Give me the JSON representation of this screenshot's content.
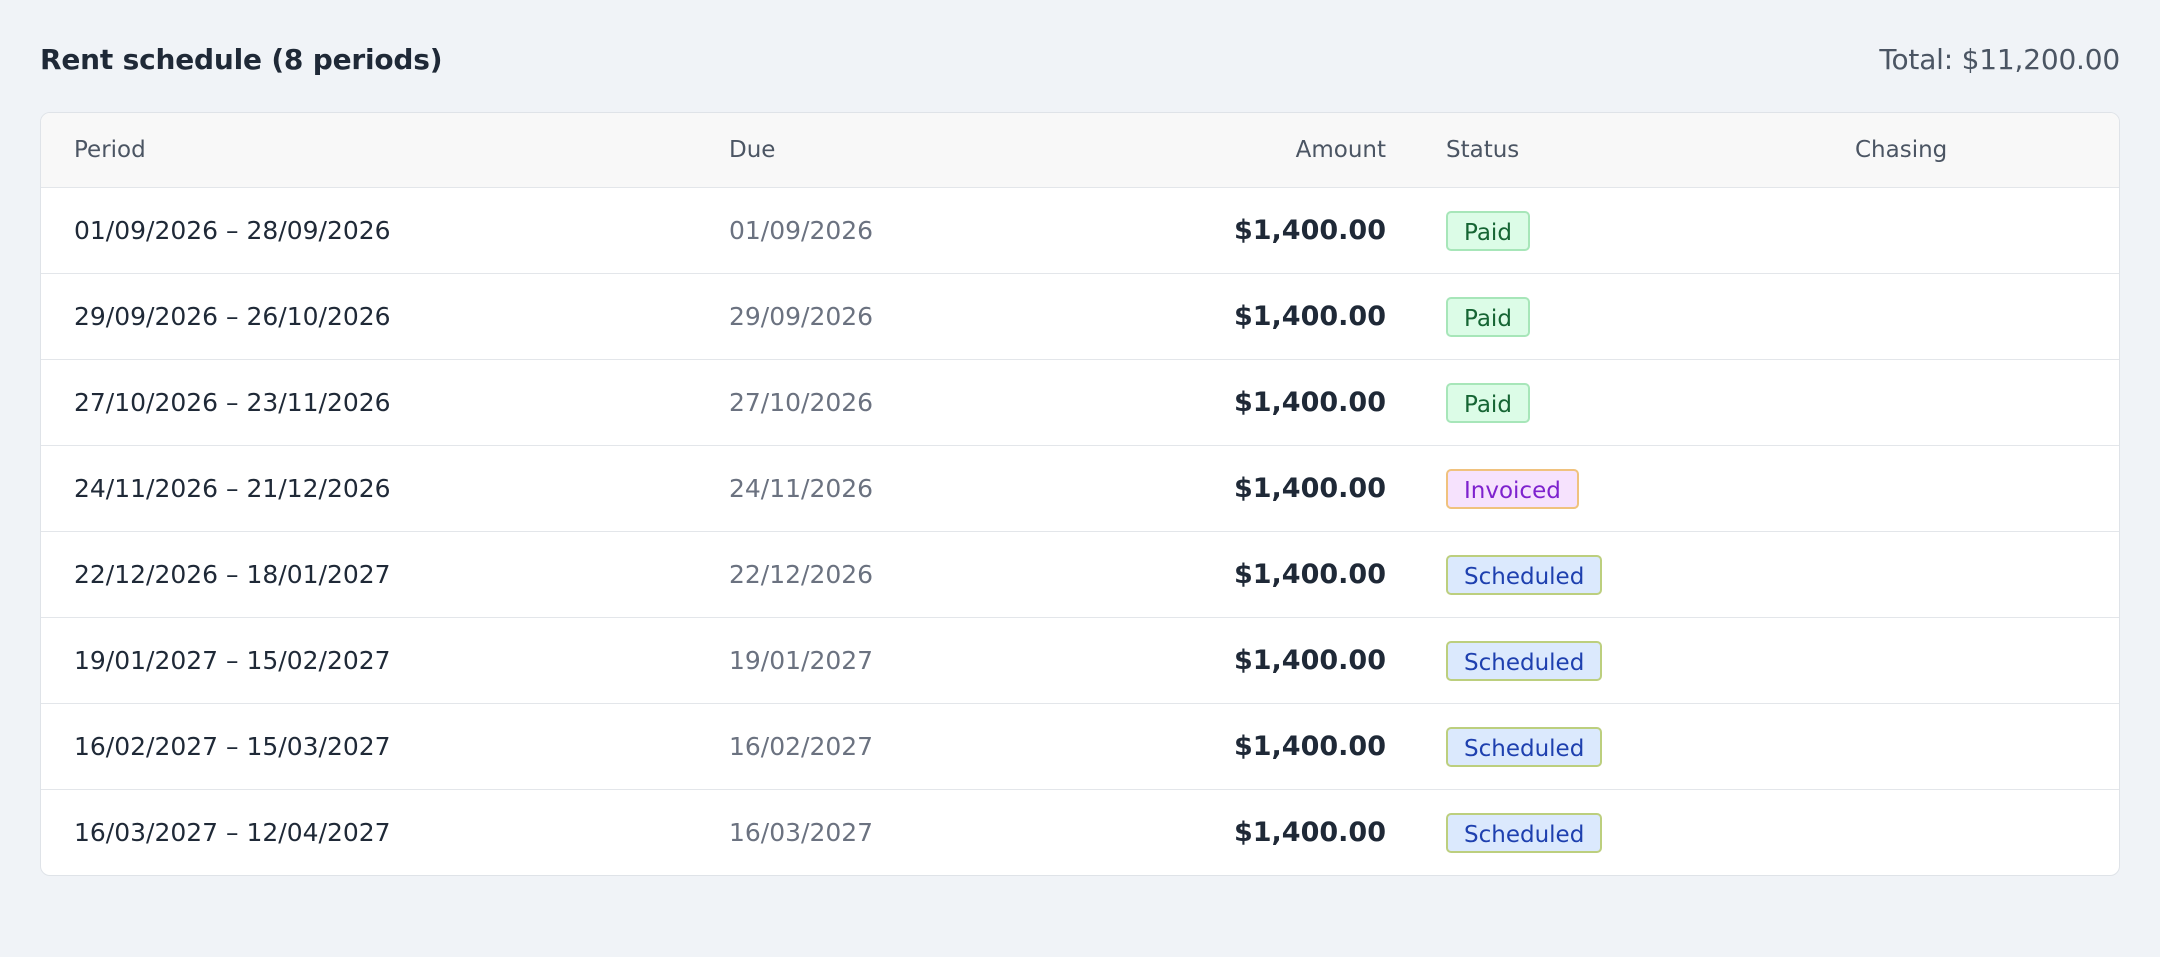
{
  "header": {
    "title": "Rent schedule (8 periods)",
    "total": "Total: $11,200.00"
  },
  "table": {
    "columns": {
      "period": "Period",
      "due": "Due",
      "amount": "Amount",
      "status": "Status",
      "chasing": "Chasing"
    },
    "rows": [
      {
        "period": "01/09/2026 – 28/09/2026",
        "due": "01/09/2026",
        "amount": "$1,400.00",
        "status": "Paid",
        "status_kind": "paid",
        "chasing": ""
      },
      {
        "period": "29/09/2026 – 26/10/2026",
        "due": "29/09/2026",
        "amount": "$1,400.00",
        "status": "Paid",
        "status_kind": "paid",
        "chasing": ""
      },
      {
        "period": "27/10/2026 – 23/11/2026",
        "due": "27/10/2026",
        "amount": "$1,400.00",
        "status": "Paid",
        "status_kind": "paid",
        "chasing": ""
      },
      {
        "period": "24/11/2026 – 21/12/2026",
        "due": "24/11/2026",
        "amount": "$1,400.00",
        "status": "Invoiced",
        "status_kind": "invoiced",
        "chasing": ""
      },
      {
        "period": "22/12/2026 – 18/01/2027",
        "due": "22/12/2026",
        "amount": "$1,400.00",
        "status": "Scheduled",
        "status_kind": "scheduled",
        "chasing": ""
      },
      {
        "period": "19/01/2027 – 15/02/2027",
        "due": "19/01/2027",
        "amount": "$1,400.00",
        "status": "Scheduled",
        "status_kind": "scheduled",
        "chasing": ""
      },
      {
        "period": "16/02/2027 – 15/03/2027",
        "due": "16/02/2027",
        "amount": "$1,400.00",
        "status": "Scheduled",
        "status_kind": "scheduled",
        "chasing": ""
      },
      {
        "period": "16/03/2027 – 12/04/2027",
        "due": "16/03/2027",
        "amount": "$1,400.00",
        "status": "Scheduled",
        "status_kind": "scheduled",
        "chasing": ""
      }
    ]
  },
  "colors": {
    "background": "#f0f3f7",
    "paid_bg": "#dcfce7",
    "paid_text": "#166534",
    "invoiced_bg": "#f6e2fd",
    "invoiced_text": "#7e22ce",
    "scheduled_bg": "#dbe9fd",
    "scheduled_text": "#1e40af"
  }
}
